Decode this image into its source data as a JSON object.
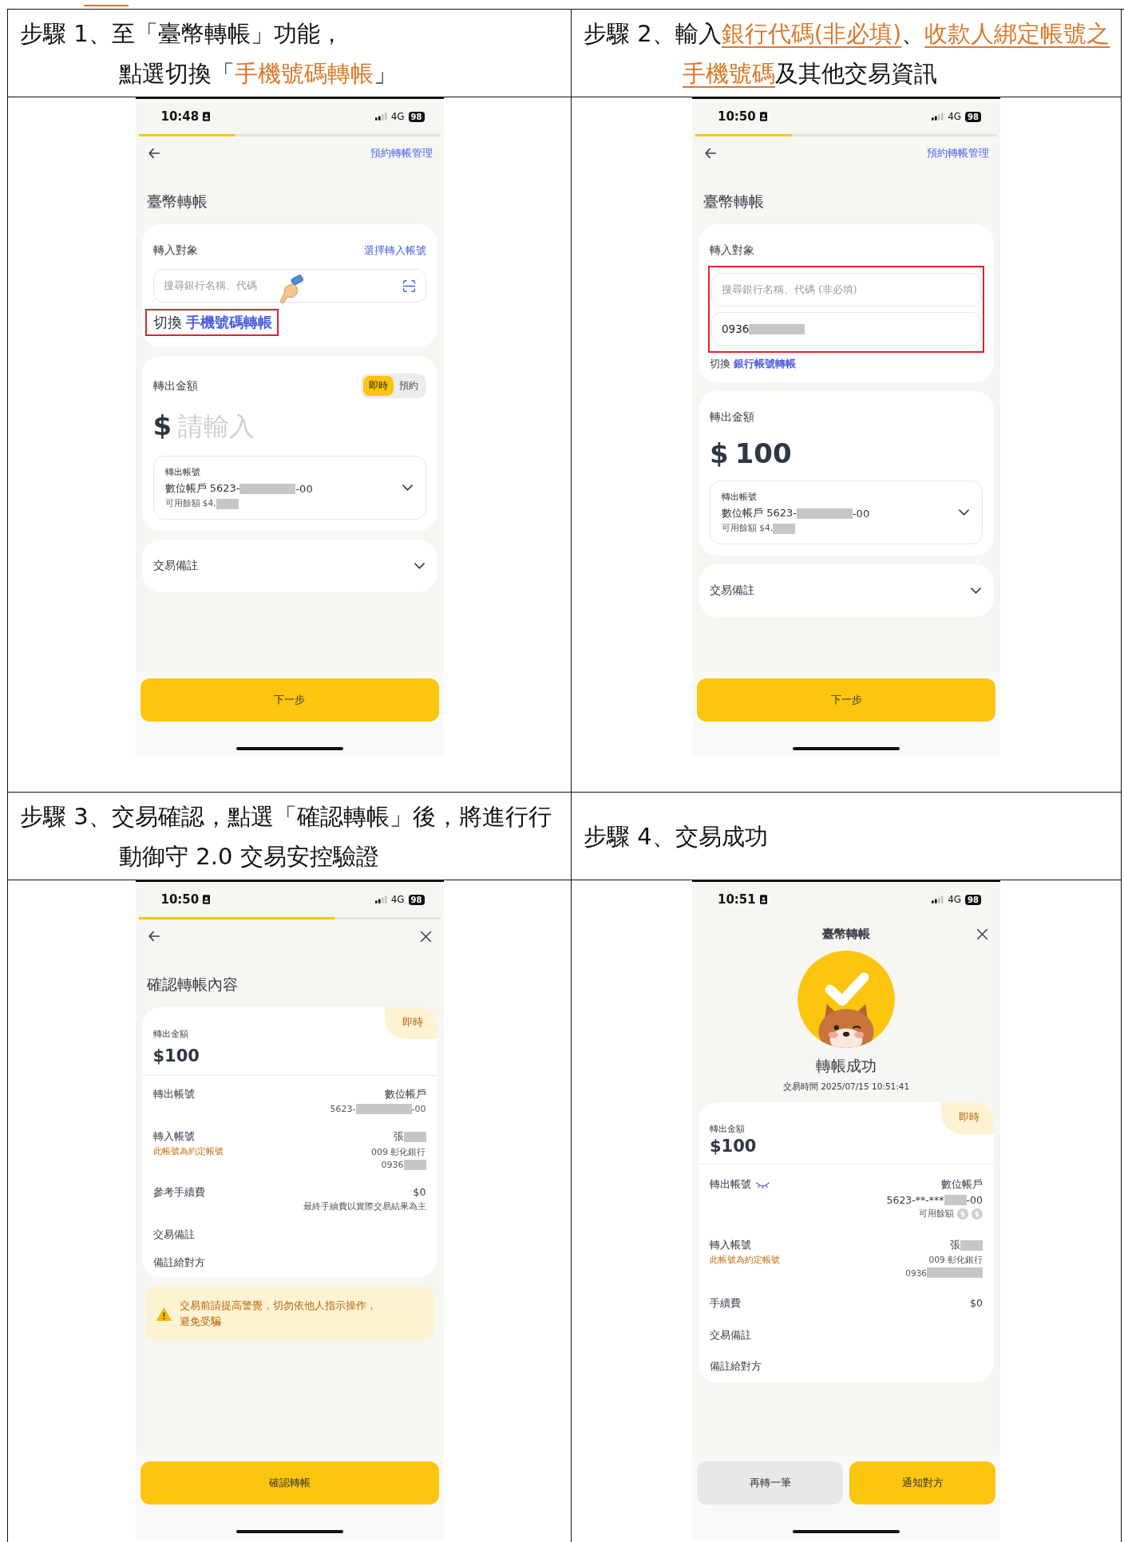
{
  "steps": [
    {
      "heading": [
        {
          "kind": "plain",
          "text": "步驟 1、至「臺幣轉帳」功能，"
        },
        {
          "kind": "break"
        },
        {
          "kind": "plain",
          "text": "點選切換「"
        },
        {
          "kind": "accent",
          "text": "手機號碼轉帳"
        },
        {
          "kind": "plain",
          "text": "」"
        }
      ],
      "screen": {
        "kind": "form",
        "status": {
          "time": "10:48",
          "network": "4G",
          "battery": "98"
        },
        "progress": {
          "level": 0.32
        },
        "nav": {
          "back": true,
          "action": "預約轉帳管理"
        },
        "title": "臺幣轉帳",
        "payee": {
          "label": "轉入對象",
          "link": "選擇轉入帳號",
          "fields_highlighted": false,
          "fields": [
            {
              "placeholder": "搜尋銀行名稱、代碼",
              "scan": true,
              "tap_hint": true
            }
          ],
          "switch": {
            "prefix": "切換",
            "link": "手機號碼轉帳",
            "highlighted": true
          }
        },
        "amount": {
          "label": "轉出金額",
          "modes": [
            {
              "label": "即時",
              "selected": true
            },
            {
              "label": "預約",
              "selected": false
            }
          ],
          "currency": "$",
          "placeholder": "請輸入",
          "account": {
            "label": "轉出帳號",
            "number": [
              {
                "kind": "text",
                "text": "數位帳戶 5623-"
              },
              {
                "kind": "mask_long"
              },
              {
                "kind": "text",
                "text": "-00"
              }
            ],
            "balance": [
              {
                "kind": "text",
                "text": "可用餘額 $4,"
              },
              {
                "kind": "mask_short"
              }
            ]
          }
        },
        "memo": {
          "label": "交易備註"
        },
        "buttons": [
          {
            "label": "下一步",
            "kind": "primary"
          }
        ]
      }
    },
    {
      "heading": [
        {
          "kind": "plain",
          "text": "步驟 2、輸入"
        },
        {
          "kind": "underline",
          "text": "銀行代碼(非必填)"
        },
        {
          "kind": "plain",
          "text": "、"
        },
        {
          "kind": "underline",
          "text": "收款人綁定帳號之手機號碼"
        },
        {
          "kind": "plain",
          "text": "及其他交易資訊"
        }
      ],
      "screen": {
        "kind": "form",
        "status": {
          "time": "10:50",
          "network": "4G",
          "battery": "98"
        },
        "progress": {
          "level": 0.32
        },
        "nav": {
          "back": true,
          "action": "預約轉帳管理"
        },
        "title": "臺幣轉帳",
        "payee": {
          "label": "轉入對象",
          "fields_highlighted": true,
          "fields": [
            {
              "placeholder": "搜尋銀行名稱、代碼 (非必填)"
            },
            {
              "value": [
                {
                  "kind": "text",
                  "text": "0936"
                },
                {
                  "kind": "mask_long"
                }
              ]
            }
          ],
          "switch": {
            "prefix": "切換",
            "link": "銀行帳號轉帳",
            "highlighted": false
          }
        },
        "amount": {
          "label": "轉出金額",
          "currency": "$",
          "value": "100",
          "account": {
            "label": "轉出帳號",
            "number": [
              {
                "kind": "text",
                "text": "數位帳戶 5623-"
              },
              {
                "kind": "mask_long"
              },
              {
                "kind": "text",
                "text": "-00"
              }
            ],
            "balance": [
              {
                "kind": "text",
                "text": "可用餘額 $4,"
              },
              {
                "kind": "mask_short"
              }
            ]
          }
        },
        "memo": {
          "label": "交易備註"
        },
        "buttons": [
          {
            "label": "下一步",
            "kind": "primary"
          }
        ]
      }
    },
    {
      "heading": [
        {
          "kind": "plain",
          "text": "步驟 3、交易確認，點選「確認轉帳」後，將進行行動御守 2.0 交易安控驗證"
        }
      ],
      "screen": {
        "kind": "review",
        "status": {
          "time": "10:50",
          "network": "4G",
          "battery": "98"
        },
        "progress": {
          "level": 0.65
        },
        "nav": {
          "back": true,
          "close": true
        },
        "title": "確認轉帳內容",
        "summary": {
          "badge": "即時",
          "label": "轉出金額",
          "amount": "$100"
        },
        "details": [
          {
            "label": "轉出帳號",
            "lines": [
              {
                "kind": "main",
                "parts": [
                  {
                    "kind": "text",
                    "text": "數位帳戶"
                  }
                ]
              },
              {
                "kind": "sub",
                "parts": [
                  {
                    "kind": "text",
                    "text": "5623-"
                  },
                  {
                    "kind": "mask_long"
                  },
                  {
                    "kind": "text",
                    "text": "-00"
                  }
                ]
              }
            ]
          },
          {
            "label": "轉入帳號",
            "note": "此帳號為約定帳號",
            "lines": [
              {
                "kind": "main",
                "parts": [
                  {
                    "kind": "text",
                    "text": "張"
                  },
                  {
                    "kind": "mask_short"
                  }
                ]
              },
              {
                "kind": "sub",
                "parts": [
                  {
                    "kind": "text",
                    "text": "009 彰化銀行"
                  }
                ]
              },
              {
                "kind": "sub",
                "parts": [
                  {
                    "kind": "text",
                    "text": "0936"
                  },
                  {
                    "kind": "mask_short"
                  }
                ]
              }
            ]
          },
          {
            "label": "參考手續費",
            "lines": [
              {
                "kind": "main",
                "parts": [
                  {
                    "kind": "text",
                    "text": "$0"
                  }
                ]
              },
              {
                "kind": "sub",
                "parts": [
                  {
                    "kind": "text",
                    "text": "最終手續費以實際交易結果為主"
                  }
                ]
              }
            ]
          },
          {
            "label": "交易備註"
          },
          {
            "label": "備註給對方"
          }
        ],
        "warning": "交易前請提高警覺，切勿依他人指示操作，避免受騙",
        "buttons": [
          {
            "label": "確認轉帳",
            "kind": "primary"
          }
        ]
      }
    },
    {
      "heading": [
        {
          "kind": "plain",
          "text": "步驟 4、交易成功"
        }
      ],
      "screen": {
        "kind": "result",
        "status": {
          "time": "10:51",
          "network": "4G",
          "battery": "98"
        },
        "nav": {
          "title": "臺幣轉帳",
          "close": true
        },
        "result": {
          "heading": "轉帳成功",
          "time": "交易時間 2025/07/15 10:51:41"
        },
        "summary": {
          "badge": "即時",
          "label": "轉出金額",
          "amount": "$100"
        },
        "details": [
          {
            "label": "轉出帳號",
            "eye": true,
            "lines": [
              {
                "kind": "main",
                "parts": [
                  {
                    "kind": "text",
                    "text": "數位帳戶"
                  }
                ]
              },
              {
                "kind": "main",
                "parts": [
                  {
                    "kind": "text",
                    "text": "5623-**-***"
                  },
                  {
                    "kind": "mask_short"
                  },
                  {
                    "kind": "text",
                    "text": "-00"
                  }
                ]
              },
              {
                "kind": "sub",
                "parts": [
                  {
                    "kind": "text",
                    "text": "可用餘額"
                  },
                  {
                    "kind": "coins"
                  }
                ]
              }
            ]
          },
          {
            "label": "轉入帳號",
            "note": "此帳號為約定帳號",
            "lines": [
              {
                "kind": "main",
                "parts": [
                  {
                    "kind": "text",
                    "text": "張"
                  },
                  {
                    "kind": "mask_short"
                  }
                ]
              },
              {
                "kind": "sub",
                "parts": [
                  {
                    "kind": "text",
                    "text": "009 彰化銀行"
                  }
                ]
              },
              {
                "kind": "sub",
                "parts": [
                  {
                    "kind": "text",
                    "text": "0936"
                  },
                  {
                    "kind": "mask_long"
                  }
                ]
              }
            ]
          },
          {
            "label": "手續費",
            "lines": [
              {
                "kind": "main",
                "parts": [
                  {
                    "kind": "text",
                    "text": "$0"
                  }
                ]
              }
            ]
          },
          {
            "label": "交易備註"
          },
          {
            "label": "備註給對方"
          }
        ],
        "buttons": [
          {
            "label": "再轉一筆",
            "kind": "secondary"
          },
          {
            "label": "通知對方",
            "kind": "primary"
          }
        ]
      }
    }
  ]
}
